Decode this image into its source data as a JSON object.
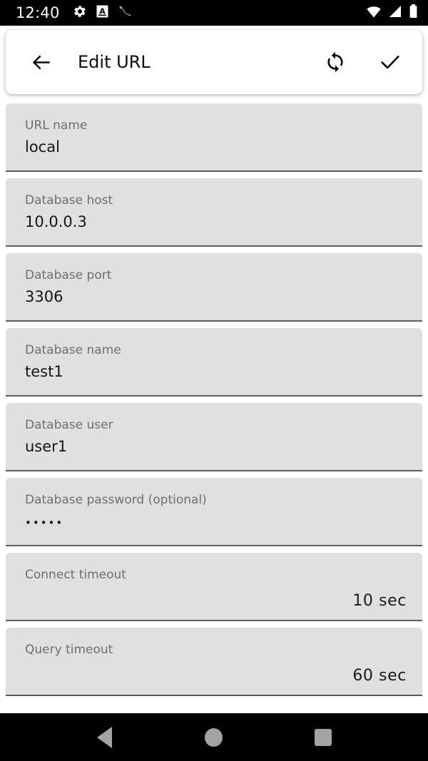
{
  "statusbar": {
    "time": "12:40",
    "left_icons": [
      {
        "name": "gear-icon",
        "label": "settings"
      },
      {
        "name": "letter-a-badge-icon",
        "label": "A"
      },
      {
        "name": "dolphin-icon",
        "label": "mysql"
      }
    ],
    "right_icons": [
      {
        "name": "wifi-icon",
        "label": "wifi"
      },
      {
        "name": "cellular-signal-icon",
        "label": "signal"
      },
      {
        "name": "battery-icon",
        "label": "battery"
      }
    ]
  },
  "toolbar": {
    "title": "Edit URL",
    "back_label": "Back",
    "sync_label": "Test connection",
    "confirm_label": "Save"
  },
  "fields": [
    {
      "label": "URL name",
      "value": "local",
      "type": "text"
    },
    {
      "label": "Database host",
      "value": "10.0.0.3",
      "type": "text"
    },
    {
      "label": "Database port",
      "value": "3306",
      "type": "text"
    },
    {
      "label": "Database name",
      "value": "test1",
      "type": "text"
    },
    {
      "label": "Database user",
      "value": "user1",
      "type": "text"
    },
    {
      "label": "Database password (optional)",
      "value": "•••••",
      "type": "password"
    },
    {
      "label": "Connect timeout",
      "value": "10 sec",
      "type": "numeric"
    },
    {
      "label": "Query timeout",
      "value": "60 sec",
      "type": "numeric"
    }
  ],
  "navbar": {
    "back_label": "Back",
    "home_label": "Home",
    "recents_label": "Recents"
  },
  "colors": {
    "field_bg": "#e0e0e0",
    "field_underline": "#5c5c5c",
    "label_text": "#6e6e6e",
    "value_text": "#151515",
    "system_bar": "#000000",
    "nav_icon": "#a3a3a3",
    "page_bg": "#ffffff"
  }
}
